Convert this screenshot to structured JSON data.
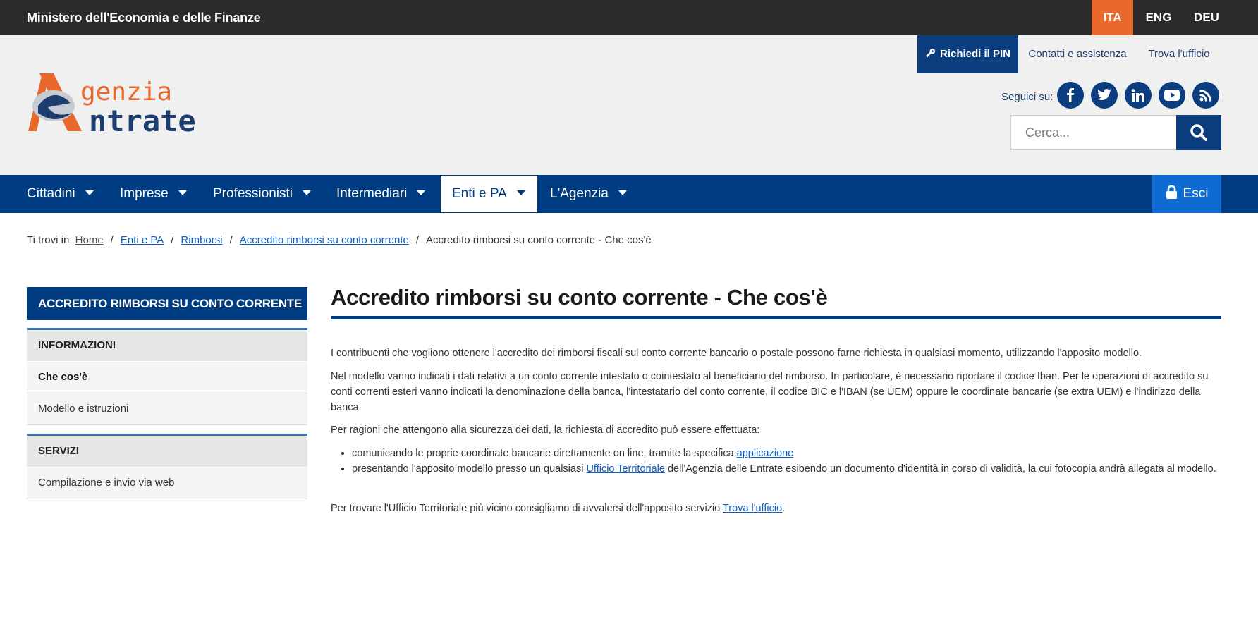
{
  "topbar": {
    "ministry": "Ministero dell'Economia e delle Finanze",
    "languages": [
      "ITA",
      "ENG",
      "DEU"
    ],
    "active_language": "ITA"
  },
  "header": {
    "logo_alt": "Agenzia Entrate",
    "logo_text_top": "genzia",
    "logo_text_bottom": "ntrate",
    "pin_button": "Richiedi il PIN",
    "contact_link": "Contatti e assistenza",
    "office_link": "Trova l'ufficio",
    "follow_label": "Seguici su:",
    "social_icons": [
      "facebook-icon",
      "twitter-icon",
      "linkedin-icon",
      "youtube-icon",
      "rss-icon"
    ],
    "search_placeholder": "Cerca..."
  },
  "nav": {
    "items": [
      "Cittadini",
      "Imprese",
      "Professionisti",
      "Intermediari",
      "Enti e PA",
      "L'Agenzia"
    ],
    "active": "Enti e PA",
    "logout": "Esci"
  },
  "breadcrumb": {
    "prefix": "Ti trovi in:",
    "links": [
      "Home",
      "Enti e PA",
      "Rimborsi",
      "Accredito rimborsi su conto corrente"
    ],
    "current": "Accredito rimborsi su conto corrente - Che cos'è"
  },
  "sidebar": {
    "title": "ACCREDITO RIMBORSI SU CONTO CORRENTE",
    "section1": "INFORMAZIONI",
    "section1_items": [
      "Che cos'è",
      "Modello e istruzioni"
    ],
    "section2": "SERVIZI",
    "section2_items": [
      "Compilazione e invio via web"
    ]
  },
  "main": {
    "title": "Accredito rimborsi su conto corrente - Che cos'è",
    "p1": "I contribuenti che vogliono ottenere l'accredito dei rimborsi fiscali sul conto corrente bancario o postale possono farne richiesta in qualsiasi momento, utilizzando l'apposito modello.",
    "p2": "Nel modello vanno indicati i dati relativi a un conto corrente intestato o cointestato al beneficiario del rimborso. In particolare, è necessario riportare il codice Iban. Per le operazioni di accredito su conti correnti esteri vanno indicati la denominazione della banca, l'intestatario del conto corrente, il codice BIC e l'IBAN (se UEM) oppure le coordinate bancarie (se extra UEM) e l'indirizzo della banca.",
    "p3": "Per ragioni che attengono alla sicurezza dei dati, la richiesta di accredito può essere effettuata:",
    "b1_text": "comunicando le proprie coordinate bancarie direttamente on line, tramite la specifica ",
    "b1_link": "applicazione",
    "b2_text_a": "presentando l'apposito modello presso un qualsiasi ",
    "b2_link": "Ufficio Territoriale",
    "b2_text_b": " dell'Agenzia delle Entrate esibendo un documento d'identità in corso di validità, la cui fotocopia andrà allegata al modello.",
    "p4_text": "Per trovare l'Ufficio Territoriale più vicino consigliamo di avvalersi dell'apposito servizio ",
    "p4_link": "Trova l'ufficio",
    "p4_end": "."
  },
  "colors": {
    "brand_blue": "#003c82",
    "accent_orange": "#e8692b",
    "logout_blue": "#0e6bd1",
    "link_blue": "#0e5fc4"
  }
}
